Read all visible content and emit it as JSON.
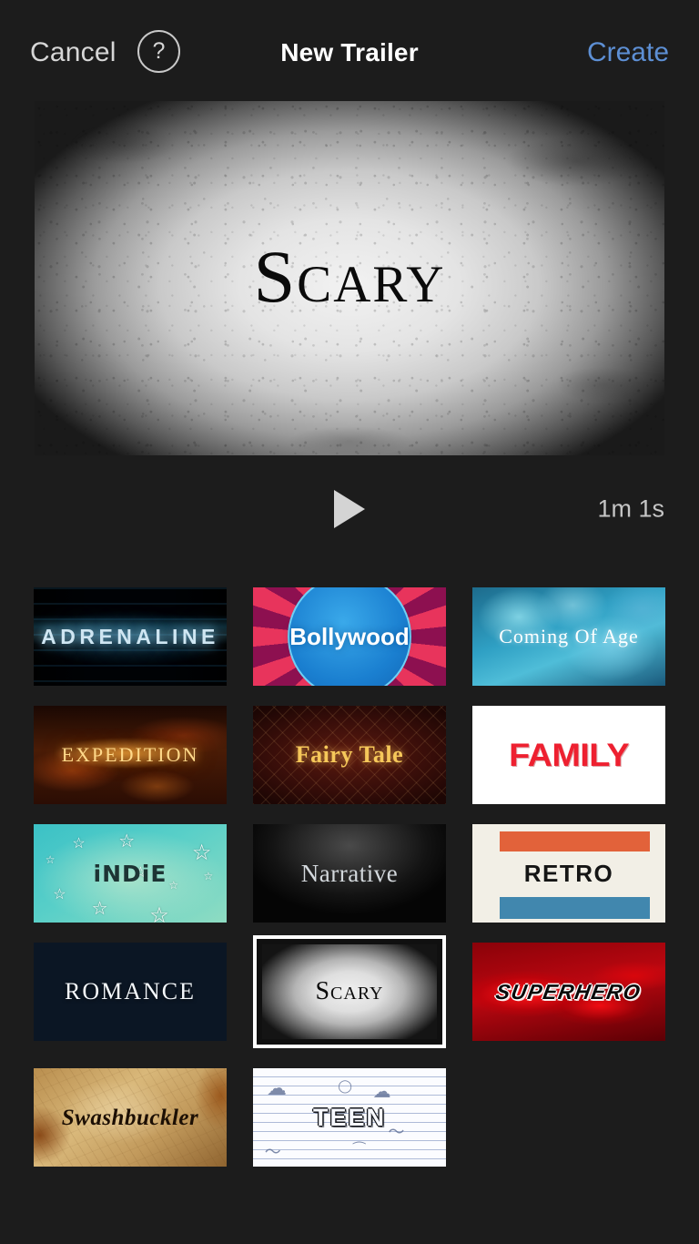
{
  "header": {
    "cancel_label": "Cancel",
    "help_glyph": "?",
    "title": "New Trailer",
    "create_label": "Create"
  },
  "preview": {
    "title": "Scary",
    "duration": "1m 1s",
    "play_label": "Play"
  },
  "templates": [
    {
      "name": "Adrenaline",
      "label": "ADRENALINE",
      "style": "t-adrenaline",
      "selected": false
    },
    {
      "name": "Bollywood",
      "label": "Bollywood",
      "style": "t-bollywood",
      "selected": false
    },
    {
      "name": "Coming Of Age",
      "label": "Coming Of Age",
      "style": "t-coming",
      "selected": false
    },
    {
      "name": "Expedition",
      "label": "EXPEDITION",
      "style": "t-expedition",
      "selected": false
    },
    {
      "name": "Fairy Tale",
      "label": "Fairy Tale",
      "style": "t-fairy",
      "selected": false
    },
    {
      "name": "Family",
      "label": "FAMILY",
      "style": "t-family",
      "selected": false
    },
    {
      "name": "Indie",
      "label": "iNDiE",
      "style": "t-indie",
      "selected": false
    },
    {
      "name": "Narrative",
      "label": "Narrative",
      "style": "t-narrative",
      "selected": false
    },
    {
      "name": "Retro",
      "label": "RETRO",
      "style": "t-retro",
      "selected": false
    },
    {
      "name": "Romance",
      "label": "ROMANCE",
      "style": "t-romance",
      "selected": false
    },
    {
      "name": "Scary",
      "label": "Scary",
      "style": "t-scary",
      "selected": true
    },
    {
      "name": "Superhero",
      "label": "SUPERHERO",
      "style": "t-superhero",
      "selected": false
    },
    {
      "name": "Swashbuckler",
      "label": "Swashbuckler",
      "style": "t-swash",
      "selected": false
    },
    {
      "name": "Teen",
      "label": "TEEN",
      "style": "t-teen",
      "selected": false
    }
  ],
  "colors": {
    "background": "#1c1c1c",
    "accent_blue": "#5d8fd4",
    "text_primary": "#ffffff",
    "text_secondary": "#d6d6d6",
    "selection_border": "#ffffff"
  }
}
